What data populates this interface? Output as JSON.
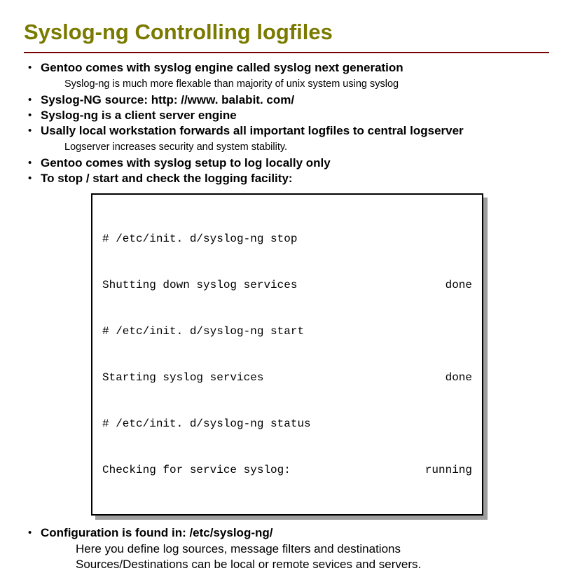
{
  "title": "Syslog-ng Controlling logfiles",
  "bullets": {
    "b1": "Gentoo comes with syslog engine called syslog next generation",
    "b1_sub": "Syslog-ng is much more flexable than majority of unix system using syslog",
    "b2": "Syslog-NG source: http: //www. balabit. com/",
    "b3": "Syslog-ng is a client server engine",
    "b4": "Usally local workstation forwards all important logfiles to central logserver",
    "b4_sub": "Logserver increases security and system stability.",
    "b5": "Gentoo comes with syslog setup to log locally only",
    "b6": "To stop / start and check the logging facility:",
    "b7": "Configuration is found in: /etc/syslog-ng/",
    "b7_sub1": "Here you define log sources, message filters and destinations",
    "b7_sub2": "Sources/Destinations can be local or remote sevices and servers."
  },
  "code": {
    "r1l": "# /etc/init. d/syslog-ng stop",
    "r1r": "",
    "r2l": "Shutting down syslog services",
    "r2r": "done",
    "r3l": "# /etc/init. d/syslog-ng start",
    "r3r": "",
    "r4l": "Starting syslog services",
    "r4r": "done",
    "r5l": "# /etc/init. d/syslog-ng status",
    "r5r": "",
    "r6l": "Checking for service syslog:",
    "r6r": "running"
  }
}
